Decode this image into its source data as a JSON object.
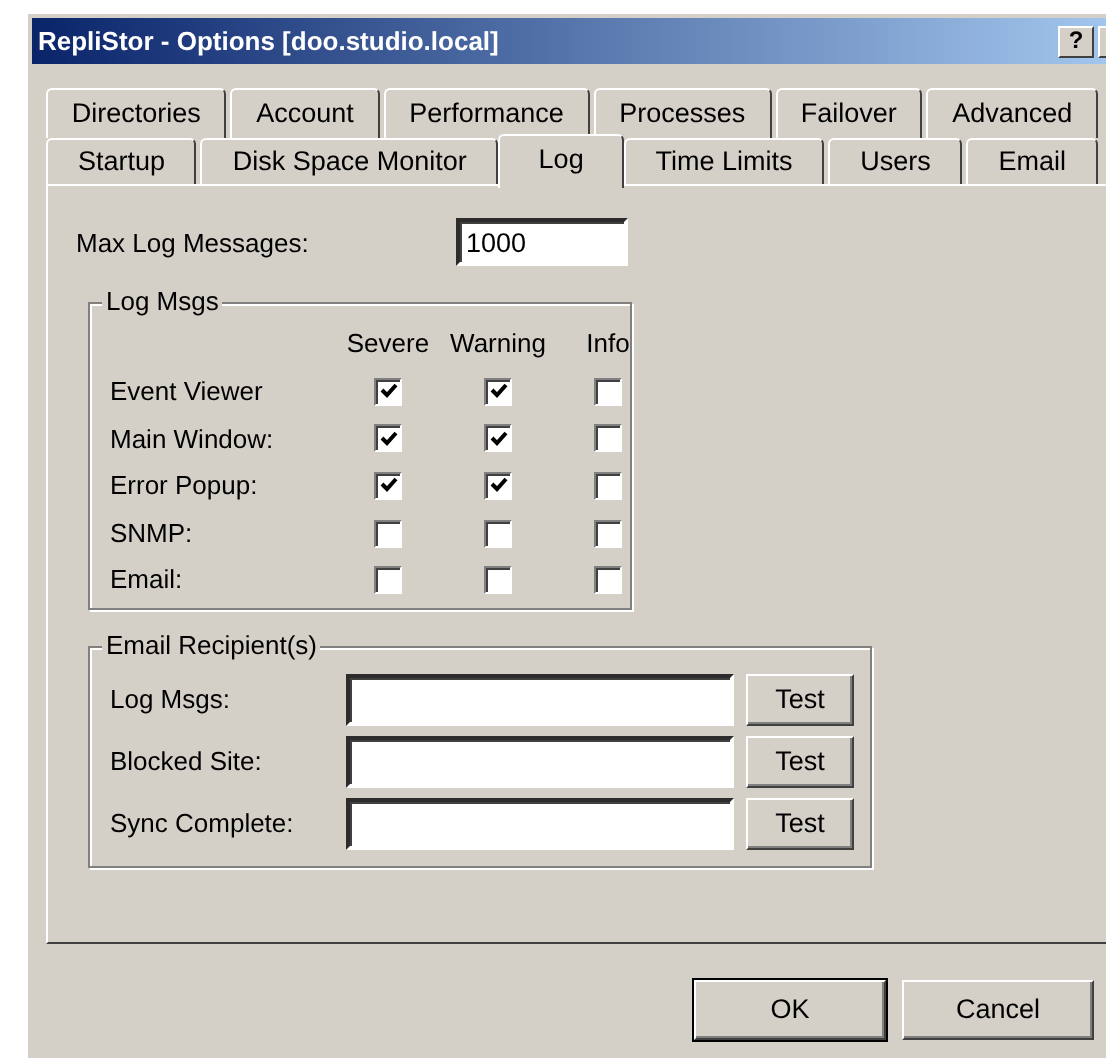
{
  "window": {
    "title": "RepliStor - Options [doo.studio.local]",
    "help_button": "?"
  },
  "tab_rows": [
    [
      {
        "label": "Directories",
        "selected": false
      },
      {
        "label": "Account",
        "selected": false
      },
      {
        "label": "Performance",
        "selected": false
      },
      {
        "label": "Processes",
        "selected": false
      },
      {
        "label": "Failover",
        "selected": false
      },
      {
        "label": "Advanced",
        "selected": false
      }
    ],
    [
      {
        "label": "Startup",
        "selected": false
      },
      {
        "label": "Disk Space Monitor",
        "selected": false
      },
      {
        "label": "Log",
        "selected": true
      },
      {
        "label": "Time Limits",
        "selected": false
      },
      {
        "label": "Users",
        "selected": false
      },
      {
        "label": "Email",
        "selected": false
      }
    ]
  ],
  "max_log_messages": {
    "label": "Max Log Messages:",
    "value": "1000"
  },
  "log_msgs": {
    "title": "Log Msgs",
    "columns": [
      "Severe",
      "Warning",
      "Info"
    ],
    "rows": [
      {
        "label": "Event Viewer",
        "checked": [
          true,
          true,
          false
        ]
      },
      {
        "label": "Main Window:",
        "checked": [
          true,
          true,
          false
        ]
      },
      {
        "label": "Error Popup:",
        "checked": [
          true,
          true,
          false
        ]
      },
      {
        "label": "SNMP:",
        "checked": [
          false,
          false,
          false
        ]
      },
      {
        "label": "Email:",
        "checked": [
          false,
          false,
          false
        ]
      }
    ]
  },
  "email_recipients": {
    "title": "Email Recipient(s)",
    "rows": [
      {
        "label": "Log Msgs:",
        "button": "Test"
      },
      {
        "label": "Blocked Site:",
        "button": "Test"
      },
      {
        "label": "Sync Complete:",
        "button": "Test"
      }
    ]
  },
  "buttons": [
    {
      "label": "OK",
      "default": true
    },
    {
      "label": "Cancel",
      "default": false
    }
  ]
}
